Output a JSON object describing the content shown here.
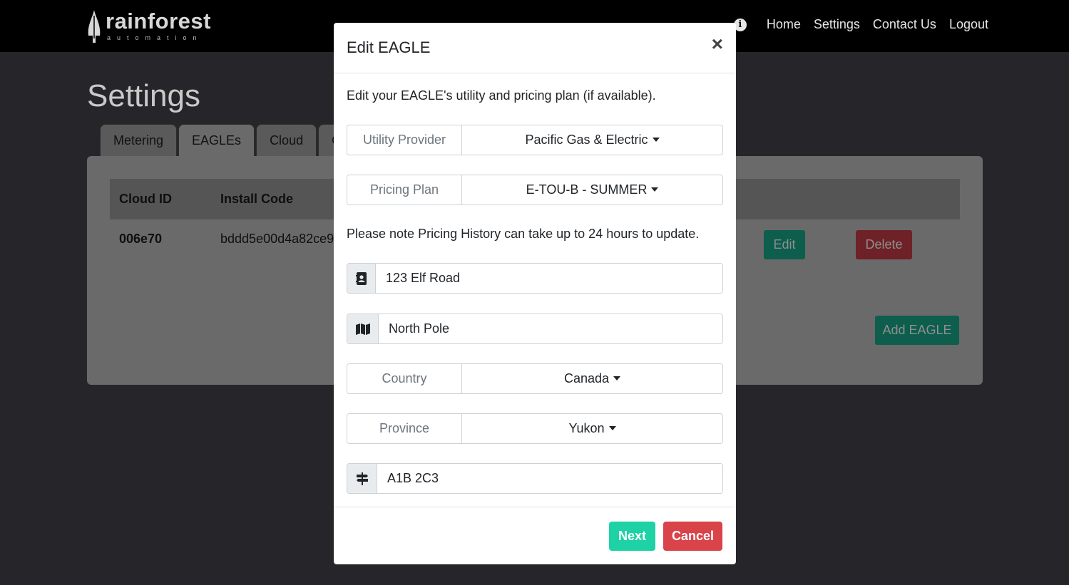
{
  "brand": {
    "name": "rainforest",
    "tagline": "automation"
  },
  "nav": {
    "links": [
      "Home",
      "Settings",
      "Contact Us",
      "Logout"
    ],
    "info_icon": "info-icon"
  },
  "page": {
    "title": "Settings"
  },
  "tabs": [
    "Metering",
    "EAGLEs",
    "Cloud",
    "C"
  ],
  "table": {
    "headers": [
      "Cloud ID",
      "Install Code"
    ],
    "row": {
      "cloud_id": "006e70",
      "install_code": "bddd5e00d4a82ce9"
    },
    "actions": {
      "edit": "Edit",
      "delete": "Delete",
      "add": "Add EAGLE"
    }
  },
  "modal": {
    "title": "Edit EAGLE",
    "close": "×",
    "description": "Edit your EAGLE's utility and pricing plan (if available).",
    "utility": {
      "label": "Utility Provider",
      "value": "Pacific Gas & Electric"
    },
    "pricing": {
      "label": "Pricing Plan",
      "value": "E-TOU-B - SUMMER"
    },
    "note": "Please note Pricing History can take up to 24 hours to update.",
    "address": {
      "value": "123 Elf Road",
      "icon": "address-card-icon"
    },
    "city": {
      "value": "North Pole",
      "icon": "map-icon"
    },
    "country": {
      "label": "Country",
      "value": "Canada"
    },
    "province": {
      "label": "Province",
      "value": "Yukon"
    },
    "postal": {
      "value": "A1B 2C3",
      "icon": "signpost-icon"
    },
    "buttons": {
      "next": "Next",
      "cancel": "Cancel"
    }
  },
  "colors": {
    "accent": "#1ed2a5",
    "danger": "#d9434a",
    "backdrop": "#26262a"
  }
}
